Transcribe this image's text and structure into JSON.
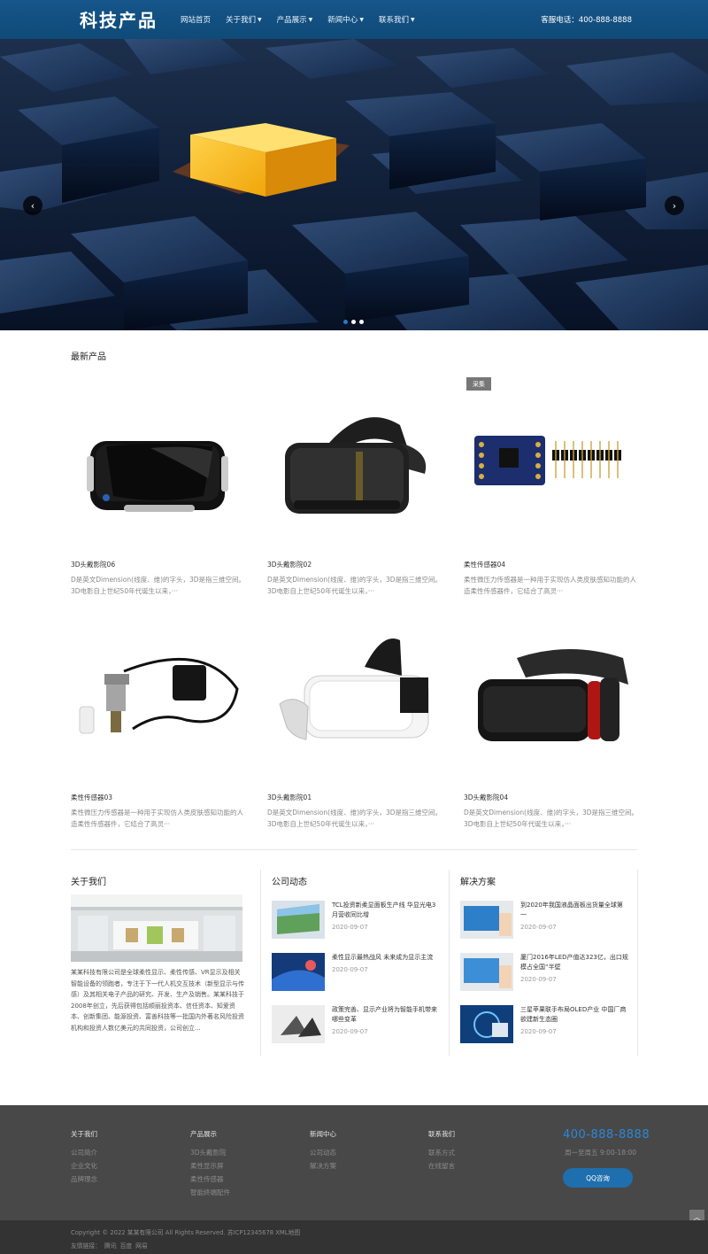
{
  "header": {
    "logo": "科技产品",
    "nav": [
      {
        "label": "网站首页",
        "dropdown": false
      },
      {
        "label": "关于我们",
        "dropdown": true
      },
      {
        "label": "产品展示",
        "dropdown": true
      },
      {
        "label": "新闻中心",
        "dropdown": true
      },
      {
        "label": "联系我们",
        "dropdown": true
      }
    ],
    "phone": "客服电话：400-888-8888"
  },
  "banner": {
    "prev_icon": "chevron-left-icon",
    "next_icon": "chevron-right-icon",
    "prev": "‹",
    "next": "›",
    "slides": 3,
    "active_slide": 1
  },
  "products": {
    "title": "最新产品",
    "badge": "采集",
    "items": [
      {
        "name": "3D头戴影院06",
        "desc": "D是英文Dimension(线度、维)的字头，3D是指三维空间。3D电影自上世纪50年代诞生以来，···"
      },
      {
        "name": "3D头戴影院02",
        "desc": "D是英文Dimension(线度、维)的字头，3D是指三维空间。3D电影自上世纪50年代诞生以来，···"
      },
      {
        "name": "柔性传感器04",
        "desc": "柔性微压力传感器是一种用于实现仿人类皮肤感知功能的人造柔性传感器件，它结合了高灵···"
      },
      {
        "name": "柔性传感器03",
        "desc": "柔性微压力传感器是一种用于实现仿人类皮肤感知功能的人造柔性传感器件，它结合了高灵···"
      },
      {
        "name": "3D头戴影院01",
        "desc": "D是英文Dimension(线度、维)的字头，3D是指三维空间。3D电影自上世纪50年代诞生以来，···"
      },
      {
        "name": "3D头戴影院04",
        "desc": "D是英文Dimension(线度、维)的字头，3D是指三维空间。3D电影自上世纪50年代诞生以来，···"
      }
    ]
  },
  "about": {
    "title": "关于我们",
    "text": "某某科技有限公司是全球柔性显示、柔性传感、VR显示及相关智能设备的领跑者，专注于下一代人机交互技术（新型显示与传感）及其相关电子产品的研究、开发、生产及销售。某某科技于2008年创立，先后获得包括顺丽投资本、信任资本、知爱资本、创新集团、能源投资、富善科技等一批国内外著名风险投资机构和投资人数亿美元的共同投资，公司创立..."
  },
  "company_news": {
    "title": "公司动态",
    "items": [
      {
        "title": "TCL投资新柔显面板生产线 华显光电3月营收同比增",
        "date": "2020-09-07"
      },
      {
        "title": "柔性显示最热战风 未来成为显示主流",
        "date": "2020-09-07"
      },
      {
        "title": "政策完善、显示产业将为智能手机带来哪些变革",
        "date": "2020-09-07"
      }
    ]
  },
  "solutions": {
    "title": "解决方案",
    "items": [
      {
        "title": "到2020年我国液晶面板出货量全球第一",
        "date": "2020-09-07"
      },
      {
        "title": "厦门2016年LED产值达323亿，出口规模占全国“半壁",
        "date": "2020-09-07"
      },
      {
        "title": "三星苹果联手布局OLED产业 中国厂商欲建新生态圈",
        "date": "2020-09-07"
      }
    ]
  },
  "footer": {
    "columns": [
      {
        "title": "关于我们",
        "links": [
          "公司简介",
          "企业文化",
          "品牌理念"
        ]
      },
      {
        "title": "产品展示",
        "links": [
          "3D头戴影院",
          "柔性显示屏",
          "柔性传感器",
          "智能终端配件"
        ]
      },
      {
        "title": "新闻中心",
        "links": [
          "公司动态",
          "解决方案"
        ]
      },
      {
        "title": "联系我们",
        "links": [
          "联系方式",
          "在线留言"
        ]
      }
    ],
    "phone": "400-888-8888",
    "hours": "周一至周五 9:00-18:00",
    "qq_button": "QQ咨询",
    "totop": "︿",
    "copyright": "Copyright © 2022 某某有限公司 All Rights Reserved. 苏ICP12345678 XML地图",
    "friend_label": "友情链接：",
    "friend_links": [
      "腾讯",
      "百度",
      "网易"
    ]
  }
}
